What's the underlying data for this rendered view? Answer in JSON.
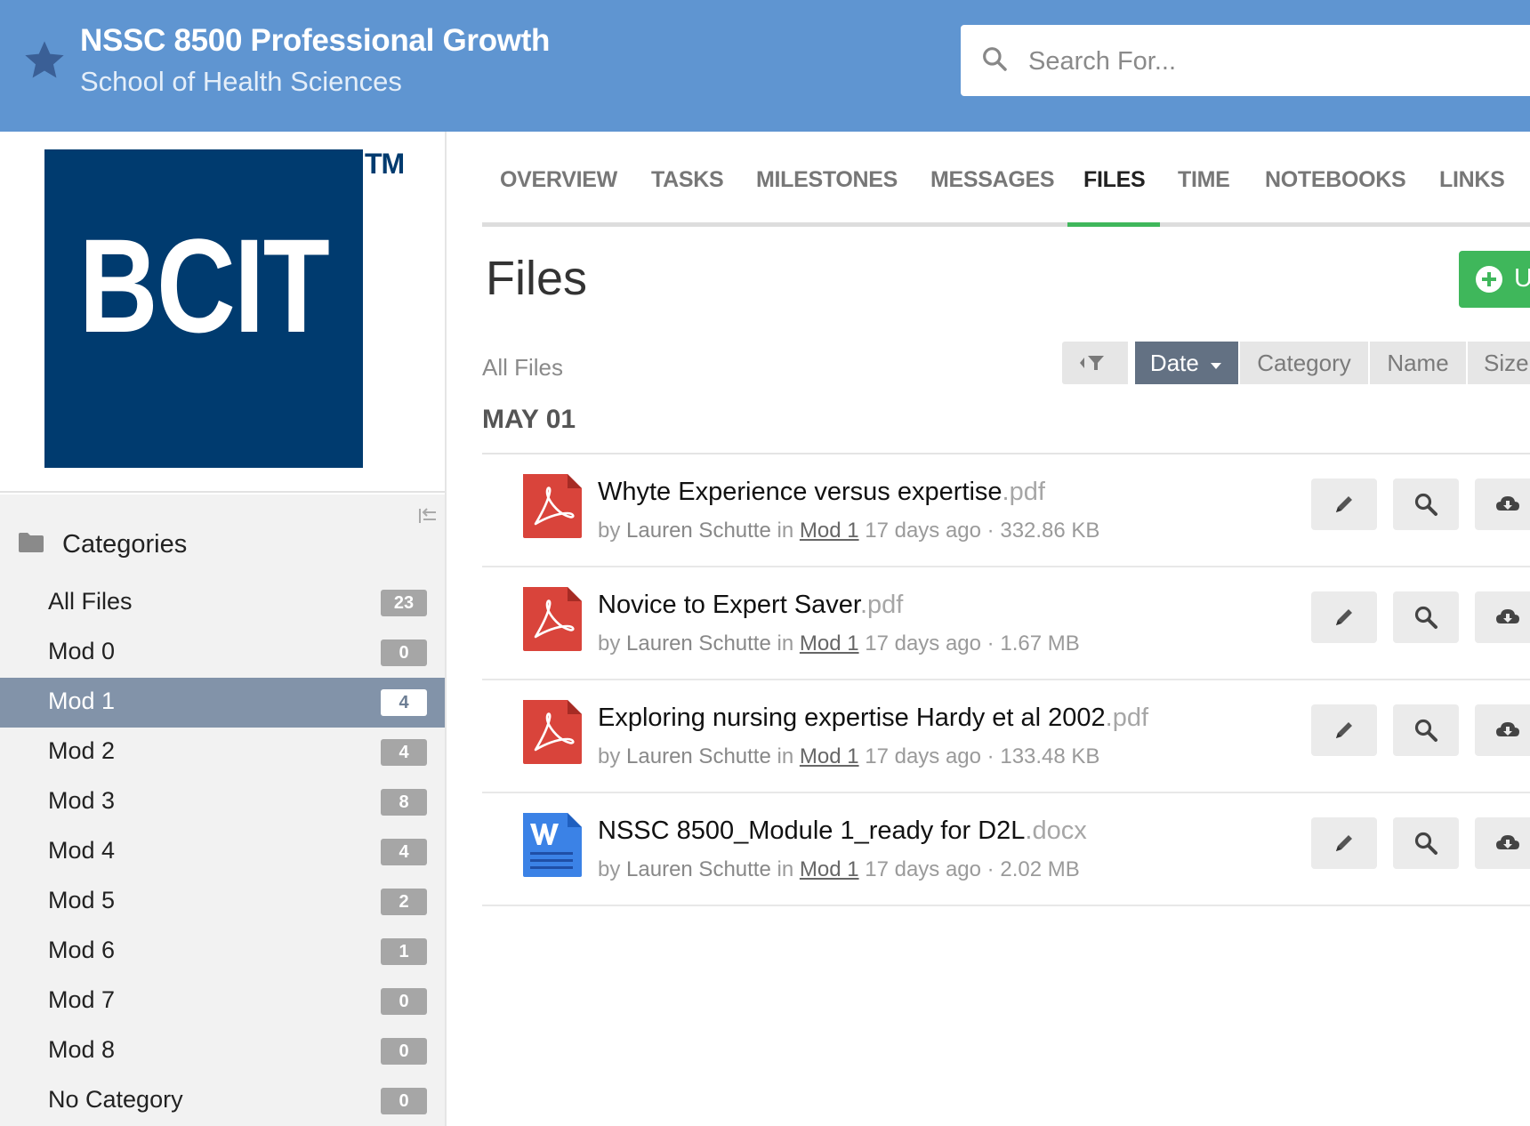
{
  "header": {
    "title": "NSSC 8500 Professional Growth",
    "subtitle": "School of Health Sciences",
    "search_placeholder": "Search For..."
  },
  "sidebar": {
    "logo_text": "BCIT",
    "logo_tm": "TM",
    "categories_title": "Categories",
    "categories": [
      {
        "label": "All Files",
        "count": "23",
        "active": false
      },
      {
        "label": "Mod 0",
        "count": "0",
        "active": false
      },
      {
        "label": "Mod 1",
        "count": "4",
        "active": true
      },
      {
        "label": "Mod 2",
        "count": "4",
        "active": false
      },
      {
        "label": "Mod 3",
        "count": "8",
        "active": false
      },
      {
        "label": "Mod 4",
        "count": "4",
        "active": false
      },
      {
        "label": "Mod 5",
        "count": "2",
        "active": false
      },
      {
        "label": "Mod 6",
        "count": "1",
        "active": false
      },
      {
        "label": "Mod 7",
        "count": "0",
        "active": false
      },
      {
        "label": "Mod 8",
        "count": "0",
        "active": false
      },
      {
        "label": "No Category",
        "count": "0",
        "active": false
      }
    ]
  },
  "tabs": {
    "overview": "OVERVIEW",
    "tasks": "TASKS",
    "milestones": "MILESTONES",
    "messages": "MESSAGES",
    "files": "FILES",
    "time": "TIME",
    "notebooks": "NOTEBOOKS",
    "links": "LINKS",
    "active": "FILES"
  },
  "main": {
    "title": "Files",
    "upload_label": "Upload",
    "breadcrumb": "All Files",
    "sort": {
      "date": "Date",
      "category": "Category",
      "name": "Name",
      "size": "Size",
      "active": "Date"
    },
    "date_heading": "MAY 01",
    "files": [
      {
        "name": "Whyte Experience versus expertise",
        "ext": ".pdf",
        "type": "pdf",
        "by": "by",
        "author": "Lauren Schutte",
        "in": "in",
        "category": "Mod 1",
        "age": "17 days ago",
        "size": "332.86 KB"
      },
      {
        "name": "Novice to Expert Saver",
        "ext": ".pdf",
        "type": "pdf",
        "by": "by",
        "author": "Lauren Schutte",
        "in": "in",
        "category": "Mod 1",
        "age": "17 days ago",
        "size": "1.67 MB"
      },
      {
        "name": "Exploring nursing expertise Hardy et al 2002",
        "ext": ".pdf",
        "type": "pdf",
        "by": "by",
        "author": "Lauren Schutte",
        "in": "in",
        "category": "Mod 1",
        "age": "17 days ago",
        "size": "133.48 KB"
      },
      {
        "name": "NSSC 8500_Module 1_ready for D2L",
        "ext": ".docx",
        "type": "docx",
        "by": "by",
        "author": "Lauren Schutte",
        "in": "in",
        "category": "Mod 1",
        "age": "17 days ago",
        "size": "2.02 MB"
      }
    ]
  },
  "icons": {
    "star": "star-icon",
    "search": "search-icon",
    "folder": "folder-icon",
    "collapse": "collapse-sidebar-icon",
    "filter": "filter-icon",
    "edit": "pencil-icon",
    "view": "magnifier-icon",
    "download": "cloud-download-icon",
    "pdf": "pdf-file-icon",
    "docx": "word-file-icon"
  },
  "colors": {
    "header_bg": "#5f95d1",
    "accent_green": "#3fb75b",
    "active_category_bg": "#8293a9",
    "sort_active_bg": "#637183",
    "pdf_red": "#d9443b",
    "word_blue": "#3b82e6",
    "logo_navy": "#003b6f"
  }
}
